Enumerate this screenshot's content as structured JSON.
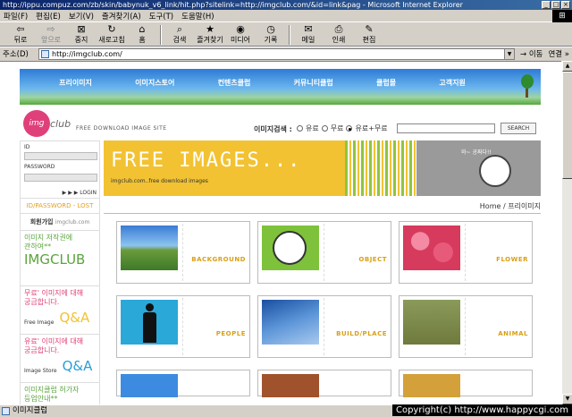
{
  "window": {
    "title": "http://ippu.compuz.com/zb/skin/babynuk_v6_link/hit.php?sitelink=http://imgclub.com/&id=link&pag - Microsoft Internet Explorer",
    "min_label": "_",
    "max_label": "□",
    "close_label": "×"
  },
  "menu": [
    "파일(F)",
    "편집(E)",
    "보기(V)",
    "즐겨찾기(A)",
    "도구(T)",
    "도움말(H)"
  ],
  "toolbar": {
    "back": "뒤로",
    "forward": "앞으로",
    "stop": "중지",
    "refresh": "새로고침",
    "home": "홈",
    "search": "검색",
    "favorites": "즐겨찾기",
    "media": "미디어",
    "history": "기록",
    "mail": "메일",
    "print": "인쇄",
    "edit": "편집"
  },
  "address": {
    "label": "주소(D)",
    "url": "http://imgclub.com/",
    "go": "이동",
    "links": "연결 »"
  },
  "site": {
    "nav": [
      "프리이미지",
      "이미지스토어",
      "컨텐츠클럽",
      "커뮤니티클럽",
      "클럽몰",
      "고객지원"
    ],
    "logo_circle": "img",
    "logo_text": "club",
    "tagline": "FREE DOWNLOAD IMAGE SITE",
    "search_label": "이미지검색 :",
    "search_options": [
      "유료",
      "무료",
      "유료+무료"
    ],
    "search_button": "SEARCH",
    "login": {
      "id_label": "ID",
      "pw_label": "PASSWORD",
      "login_button": "▶ ▶ ▶ LOGIN",
      "lost": "ID/PASSWORD - LOST",
      "join": "회원가입",
      "join_site": "imgclub.com"
    },
    "side_boxes": [
      {
        "line1": "이미지 저작권에",
        "line2": "관하여**",
        "big": "IMGCLUB",
        "small": ""
      },
      {
        "line1": "무료' 이미지에 대해",
        "line2": "궁금합니다.",
        "big": "Q&A",
        "small": "Free Image"
      },
      {
        "line1": "유료' 이미지에 대해",
        "line2": "궁금합니다.",
        "big": "Q&A",
        "small": "Image Store"
      },
      {
        "line1": "이미지클럽 허가자",
        "line2": "등업안내**",
        "big": "",
        "small": ""
      }
    ],
    "banner": {
      "title": "FREE IMAGES...",
      "sub": "imgclub.com..free download images",
      "speech": "와~ 공짜다!!"
    },
    "breadcrumb": "Home / 프리이미지",
    "categories": [
      {
        "label": "BACKGROUND"
      },
      {
        "label": "OBJECT"
      },
      {
        "label": "FLOWER"
      },
      {
        "label": "PEOPLE"
      },
      {
        "label": "BUILD/PLACE"
      },
      {
        "label": "ANIMAL"
      }
    ]
  },
  "status": {
    "text": "이미지클럽",
    "copyright": "Copyright(c) http://www.happycgi.com"
  }
}
